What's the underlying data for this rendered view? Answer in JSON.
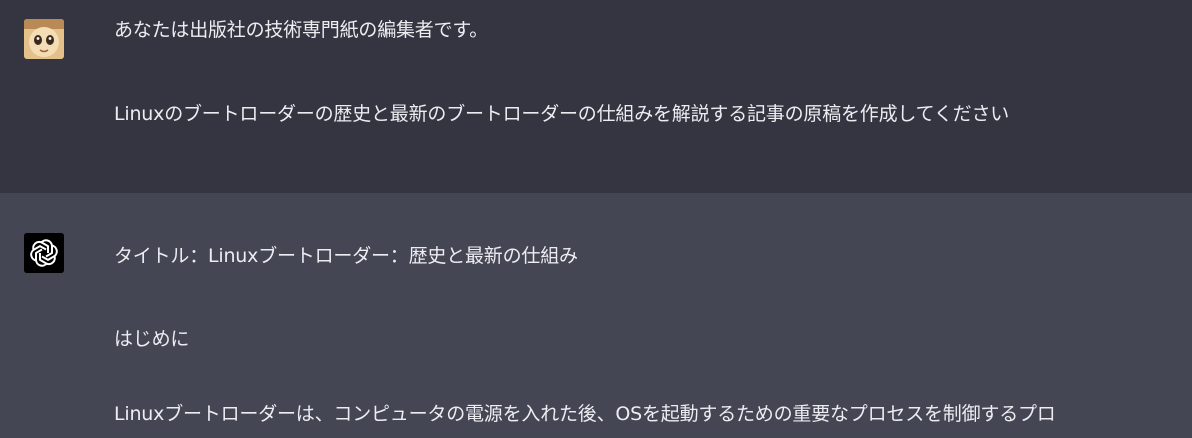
{
  "user_message": {
    "avatar_icon": "user-avatar",
    "paragraphs": [
      "あなたは出版社の技術専門紙の編集者です。",
      "Linuxのブートローダーの歴史と最新のブートローダーの仕組みを解説する記事の原稿を作成してください"
    ]
  },
  "assistant_message": {
    "avatar_icon": "openai-logo-icon",
    "paragraphs": [
      "タイトル：Linuxブートローダー：歴史と最新の仕組み",
      "はじめに",
      "Linuxブートローダーは、コンピュータの電源を入れた後、OSを起動するための重要なプロセスを制御するプロ"
    ]
  },
  "colors": {
    "user_bg": "#343541",
    "assistant_bg": "#444654",
    "text": "#ececf1",
    "logo_bg": "#000000"
  }
}
